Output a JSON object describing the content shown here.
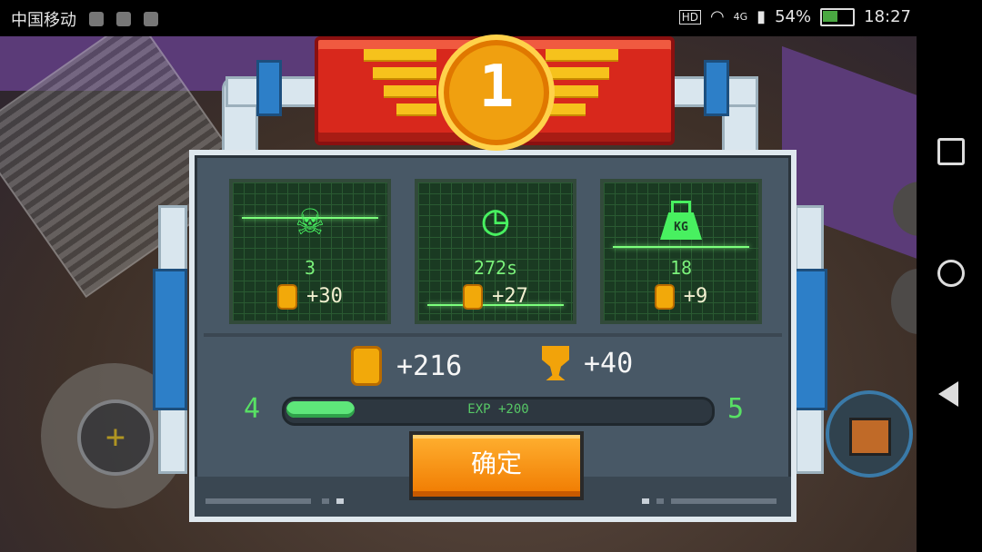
{
  "status_bar": {
    "carrier": "中国移动",
    "network": "4G",
    "hd": "HD",
    "battery_percent": "54%",
    "battery_level": 0.54,
    "time": "18:27"
  },
  "results": {
    "rank": "1",
    "stats": [
      {
        "icon": "skull-crossbones-icon",
        "value": "3",
        "coins": "+30"
      },
      {
        "icon": "clock-icon",
        "value": "272s",
        "coins": "+27"
      },
      {
        "icon": "weight-kg-icon",
        "icon_label": "KG",
        "value": "18",
        "coins": "+9"
      }
    ],
    "total_coins": "+216",
    "trophies": "+40",
    "level_current": "4",
    "level_next": "5",
    "exp_label": "EXP +200",
    "exp_fraction": 0.16,
    "confirm_label": "确定"
  },
  "colors": {
    "accent_green": "#48f060",
    "coin_gold": "#f2a90a",
    "button_orange": "#f07a00",
    "ribbon_red": "#d8281c"
  }
}
